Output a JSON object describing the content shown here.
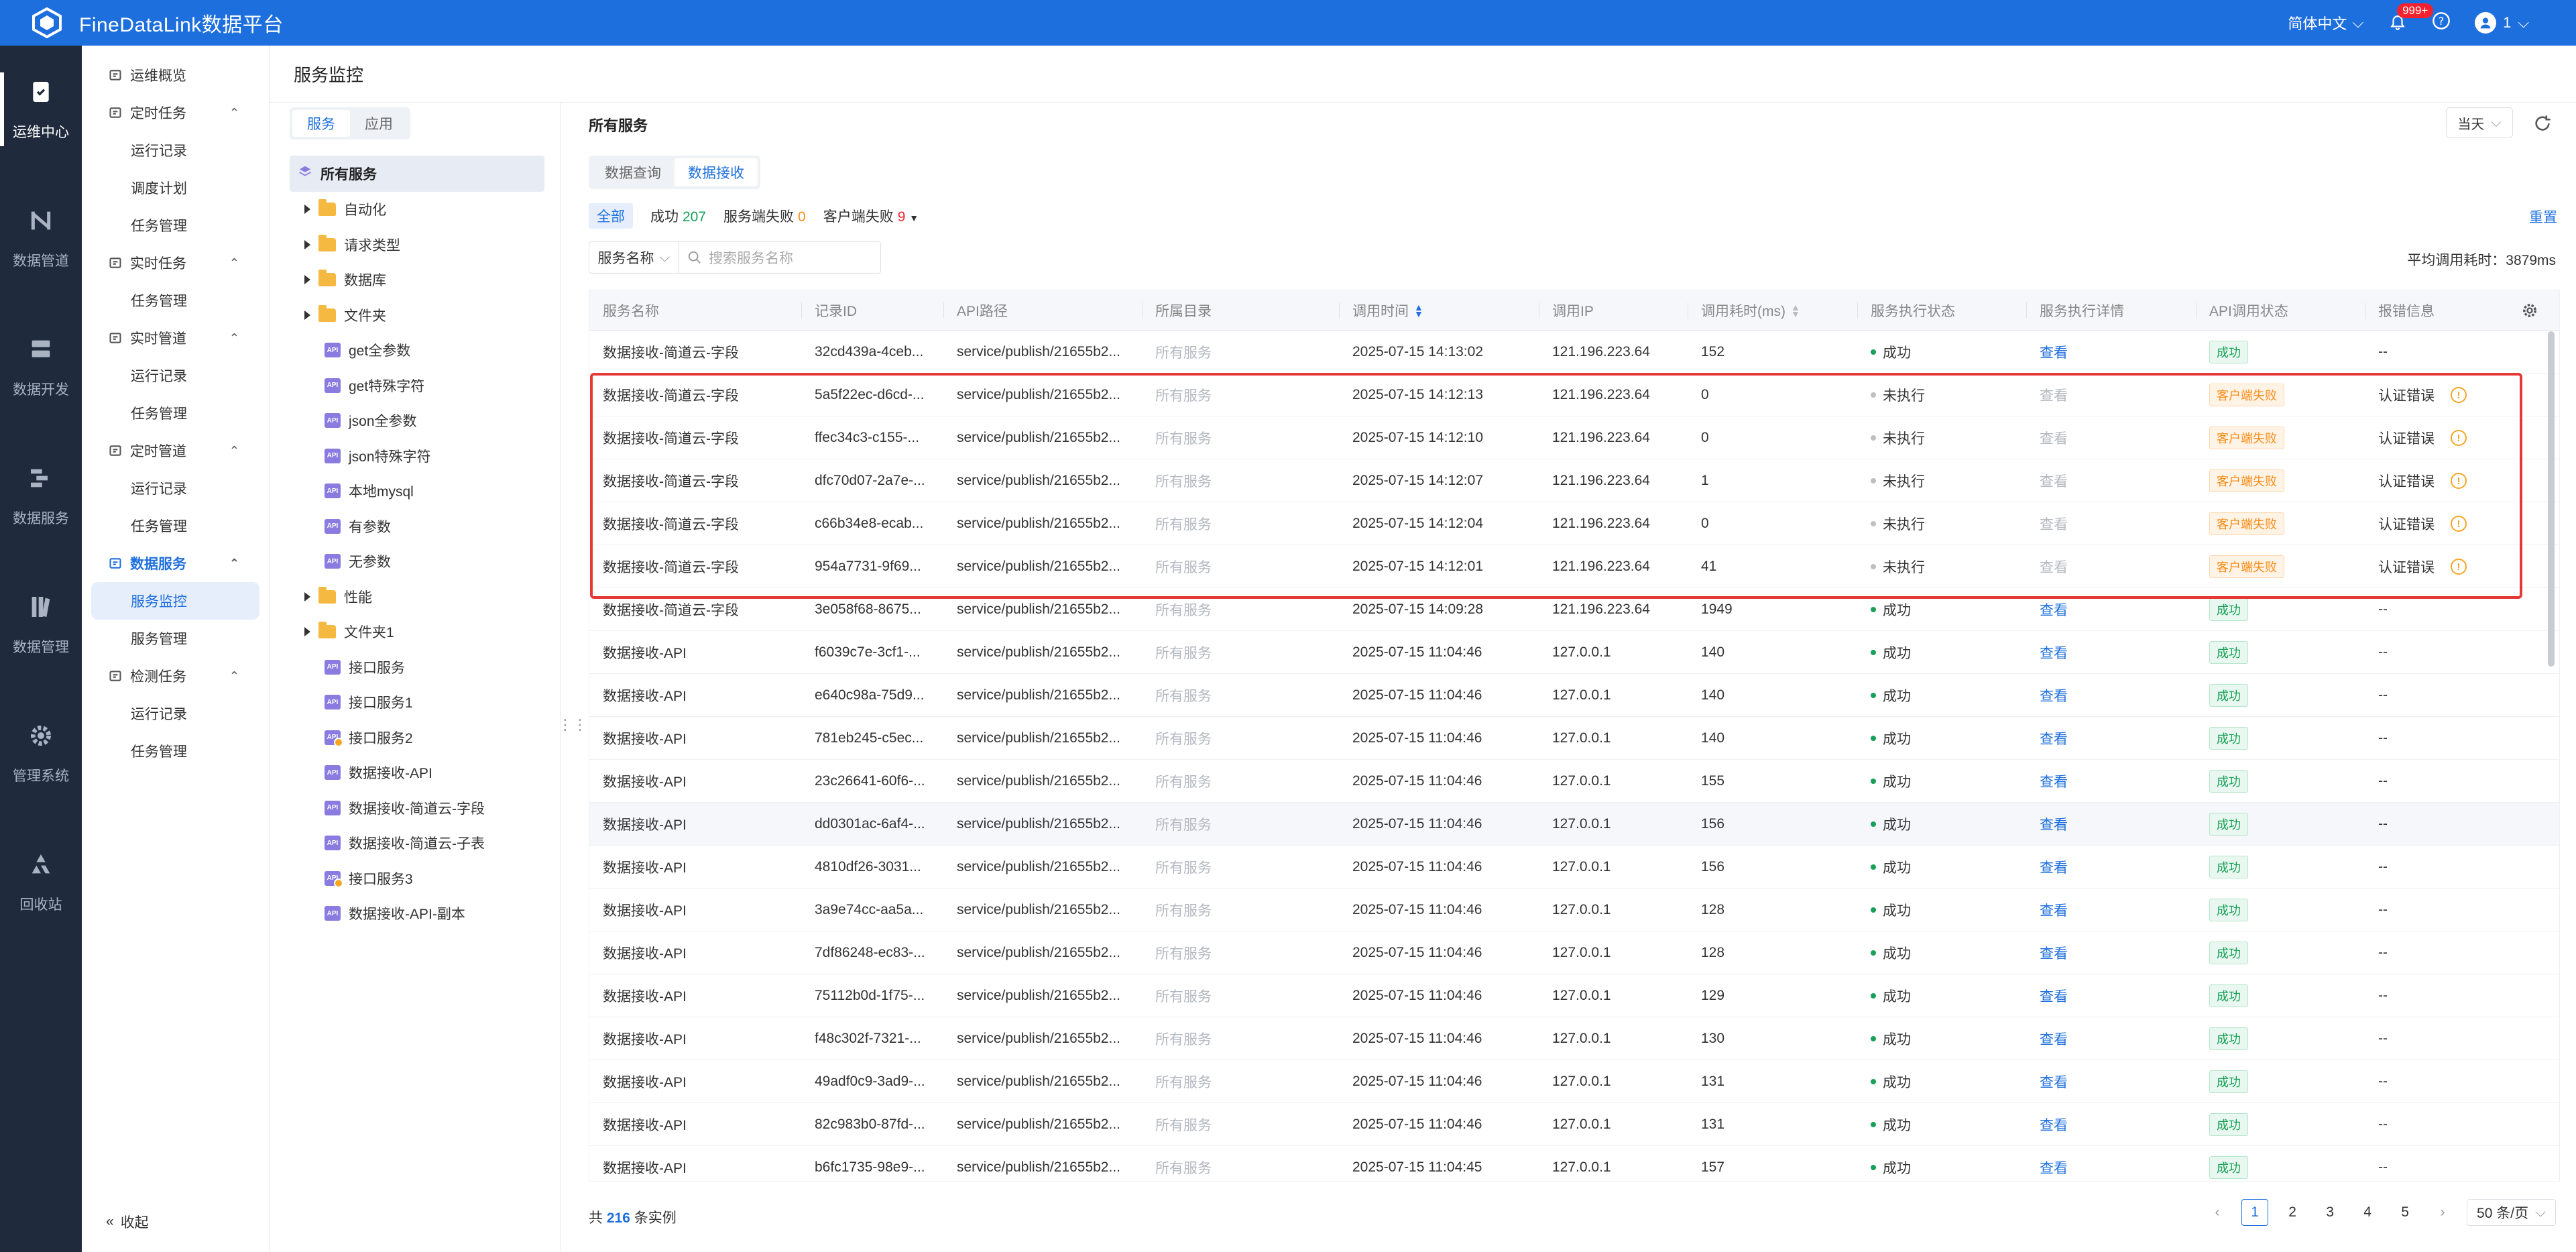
{
  "app": {
    "title": "FineDataLink数据平台"
  },
  "header": {
    "language": "简体中文",
    "notifications_count": "999+",
    "user": "1"
  },
  "rail": [
    {
      "label": "运维中心",
      "icon": "clipboard-icon",
      "active": true
    },
    {
      "label": "数据管道",
      "icon": "pipeline-icon"
    },
    {
      "label": "数据开发",
      "icon": "database-icon"
    },
    {
      "label": "数据服务",
      "icon": "service-icon"
    },
    {
      "label": "数据管理",
      "icon": "management-icon"
    },
    {
      "label": "管理系统",
      "icon": "gear-icon"
    },
    {
      "label": "回收站",
      "icon": "recycle-icon"
    }
  ],
  "menu": {
    "items": [
      {
        "type": "group",
        "label": "运维概览",
        "caret": false
      },
      {
        "type": "group",
        "label": "定时任务",
        "caret": true
      },
      {
        "type": "sub",
        "label": "运行记录"
      },
      {
        "type": "sub",
        "label": "调度计划"
      },
      {
        "type": "sub",
        "label": "任务管理"
      },
      {
        "type": "group",
        "label": "实时任务",
        "caret": true
      },
      {
        "type": "sub",
        "label": "任务管理"
      },
      {
        "type": "group",
        "label": "实时管道",
        "caret": true
      },
      {
        "type": "sub",
        "label": "运行记录"
      },
      {
        "type": "sub",
        "label": "任务管理"
      },
      {
        "type": "group",
        "label": "定时管道",
        "caret": true
      },
      {
        "type": "sub",
        "label": "运行记录"
      },
      {
        "type": "sub",
        "label": "任务管理"
      },
      {
        "type": "group",
        "label": "数据服务",
        "caret": true,
        "on": true
      },
      {
        "type": "sub",
        "label": "服务监控",
        "active": true
      },
      {
        "type": "sub",
        "label": "服务管理"
      },
      {
        "type": "group",
        "label": "检测任务",
        "caret": true
      },
      {
        "type": "sub",
        "label": "运行记录"
      },
      {
        "type": "sub",
        "label": "任务管理"
      }
    ],
    "collapse_label": "收起"
  },
  "page": {
    "title": "服务监控"
  },
  "tree": {
    "seg_tabs": [
      "服务",
      "应用"
    ],
    "root": "所有服务",
    "nodes": [
      {
        "label": "自动化",
        "kind": "folder"
      },
      {
        "label": "请求类型",
        "kind": "folder"
      },
      {
        "label": "数据库",
        "kind": "folder"
      },
      {
        "label": "文件夹",
        "kind": "folder"
      },
      {
        "label": "get全参数",
        "kind": "api"
      },
      {
        "label": "get特殊字符",
        "kind": "api"
      },
      {
        "label": "json全参数",
        "kind": "api"
      },
      {
        "label": "json特殊字符",
        "kind": "api"
      },
      {
        "label": "本地mysql",
        "kind": "api"
      },
      {
        "label": "有参数",
        "kind": "api"
      },
      {
        "label": "无参数",
        "kind": "api"
      },
      {
        "label": "性能",
        "kind": "folder"
      },
      {
        "label": "文件夹1",
        "kind": "folder"
      },
      {
        "label": "接口服务",
        "kind": "api"
      },
      {
        "label": "接口服务1",
        "kind": "api"
      },
      {
        "label": "接口服务2",
        "kind": "api-warn"
      },
      {
        "label": "数据接收-API",
        "kind": "api"
      },
      {
        "label": "数据接收-简道云-字段",
        "kind": "api"
      },
      {
        "label": "数据接收-简道云-子表",
        "kind": "api"
      },
      {
        "label": "接口服务3",
        "kind": "api-warn"
      },
      {
        "label": "数据接收-API-副本",
        "kind": "api"
      }
    ]
  },
  "main": {
    "title": "所有服务",
    "range": "当天",
    "tabs": [
      "数据查询",
      "数据接收"
    ],
    "filters": {
      "all": "全部",
      "success_label": "成功",
      "success_count": "207",
      "server_fail_label": "服务端失败",
      "server_fail_count": "0",
      "client_fail_label": "客户端失败",
      "client_fail_count": "9"
    },
    "reset": "重置",
    "search_select": "服务名称",
    "search_placeholder": "搜索服务名称",
    "avg_label": "平均调用耗时：3879ms"
  },
  "table": {
    "columns": [
      "服务名称",
      "记录ID",
      "API路径",
      "所属目录",
      "调用时间",
      "调用IP",
      "调用耗时(ms)",
      "服务执行状态",
      "服务执行详情",
      "API调用状态",
      "报错信息"
    ],
    "rows": [
      {
        "name": "数据接收-简道云-字段",
        "id": "32cd439a-4ceb...",
        "path": "service/publish/21655b2...",
        "dir": "所有服务",
        "time": "2025-07-15 14:13:02",
        "ip": "121.196.223.64",
        "cost": "152",
        "exec": "成功",
        "detail": "查看",
        "api": "成功",
        "err": "--"
      },
      {
        "name": "数据接收-简道云-字段",
        "id": "5a5f22ec-d6cd-...",
        "path": "service/publish/21655b2...",
        "dir": "所有服务",
        "time": "2025-07-15 14:12:13",
        "ip": "121.196.223.64",
        "cost": "0",
        "exec": "未执行",
        "detail": "查看",
        "api": "客户端失败",
        "err": "认证错误"
      },
      {
        "name": "数据接收-简道云-字段",
        "id": "ffec34c3-c155-...",
        "path": "service/publish/21655b2...",
        "dir": "所有服务",
        "time": "2025-07-15 14:12:10",
        "ip": "121.196.223.64",
        "cost": "0",
        "exec": "未执行",
        "detail": "查看",
        "api": "客户端失败",
        "err": "认证错误"
      },
      {
        "name": "数据接收-简道云-字段",
        "id": "dfc70d07-2a7e-...",
        "path": "service/publish/21655b2...",
        "dir": "所有服务",
        "time": "2025-07-15 14:12:07",
        "ip": "121.196.223.64",
        "cost": "1",
        "exec": "未执行",
        "detail": "查看",
        "api": "客户端失败",
        "err": "认证错误"
      },
      {
        "name": "数据接收-简道云-字段",
        "id": "c66b34e8-ecab...",
        "path": "service/publish/21655b2...",
        "dir": "所有服务",
        "time": "2025-07-15 14:12:04",
        "ip": "121.196.223.64",
        "cost": "0",
        "exec": "未执行",
        "detail": "查看",
        "api": "客户端失败",
        "err": "认证错误"
      },
      {
        "name": "数据接收-简道云-字段",
        "id": "954a7731-9f69...",
        "path": "service/publish/21655b2...",
        "dir": "所有服务",
        "time": "2025-07-15 14:12:01",
        "ip": "121.196.223.64",
        "cost": "41",
        "exec": "未执行",
        "detail": "查看",
        "api": "客户端失败",
        "err": "认证错误"
      },
      {
        "name": "数据接收-简道云-字段",
        "id": "3e058f68-8675...",
        "path": "service/publish/21655b2...",
        "dir": "所有服务",
        "time": "2025-07-15 14:09:28",
        "ip": "121.196.223.64",
        "cost": "1949",
        "exec": "成功",
        "detail": "查看",
        "api": "成功",
        "err": "--"
      },
      {
        "name": "数据接收-API",
        "id": "f6039c7e-3cf1-...",
        "path": "service/publish/21655b2...",
        "dir": "所有服务",
        "time": "2025-07-15 11:04:46",
        "ip": "127.0.0.1",
        "cost": "140",
        "exec": "成功",
        "detail": "查看",
        "api": "成功",
        "err": "--"
      },
      {
        "name": "数据接收-API",
        "id": "e640c98a-75d9...",
        "path": "service/publish/21655b2...",
        "dir": "所有服务",
        "time": "2025-07-15 11:04:46",
        "ip": "127.0.0.1",
        "cost": "140",
        "exec": "成功",
        "detail": "查看",
        "api": "成功",
        "err": "--"
      },
      {
        "name": "数据接收-API",
        "id": "781eb245-c5ec...",
        "path": "service/publish/21655b2...",
        "dir": "所有服务",
        "time": "2025-07-15 11:04:46",
        "ip": "127.0.0.1",
        "cost": "140",
        "exec": "成功",
        "detail": "查看",
        "api": "成功",
        "err": "--"
      },
      {
        "name": "数据接收-API",
        "id": "23c26641-60f6-...",
        "path": "service/publish/21655b2...",
        "dir": "所有服务",
        "time": "2025-07-15 11:04:46",
        "ip": "127.0.0.1",
        "cost": "155",
        "exec": "成功",
        "detail": "查看",
        "api": "成功",
        "err": "--"
      },
      {
        "name": "数据接收-API",
        "id": "dd0301ac-6af4-...",
        "path": "service/publish/21655b2...",
        "dir": "所有服务",
        "time": "2025-07-15 11:04:46",
        "ip": "127.0.0.1",
        "cost": "156",
        "exec": "成功",
        "detail": "查看",
        "api": "成功",
        "err": "--"
      },
      {
        "name": "数据接收-API",
        "id": "4810df26-3031...",
        "path": "service/publish/21655b2...",
        "dir": "所有服务",
        "time": "2025-07-15 11:04:46",
        "ip": "127.0.0.1",
        "cost": "156",
        "exec": "成功",
        "detail": "查看",
        "api": "成功",
        "err": "--"
      },
      {
        "name": "数据接收-API",
        "id": "3a9e74cc-aa5a...",
        "path": "service/publish/21655b2...",
        "dir": "所有服务",
        "time": "2025-07-15 11:04:46",
        "ip": "127.0.0.1",
        "cost": "128",
        "exec": "成功",
        "detail": "查看",
        "api": "成功",
        "err": "--"
      },
      {
        "name": "数据接收-API",
        "id": "7df86248-ec83-...",
        "path": "service/publish/21655b2...",
        "dir": "所有服务",
        "time": "2025-07-15 11:04:46",
        "ip": "127.0.0.1",
        "cost": "128",
        "exec": "成功",
        "detail": "查看",
        "api": "成功",
        "err": "--"
      },
      {
        "name": "数据接收-API",
        "id": "75112b0d-1f75-...",
        "path": "service/publish/21655b2...",
        "dir": "所有服务",
        "time": "2025-07-15 11:04:46",
        "ip": "127.0.0.1",
        "cost": "129",
        "exec": "成功",
        "detail": "查看",
        "api": "成功",
        "err": "--"
      },
      {
        "name": "数据接收-API",
        "id": "f48c302f-7321-...",
        "path": "service/publish/21655b2...",
        "dir": "所有服务",
        "time": "2025-07-15 11:04:46",
        "ip": "127.0.0.1",
        "cost": "130",
        "exec": "成功",
        "detail": "查看",
        "api": "成功",
        "err": "--"
      },
      {
        "name": "数据接收-API",
        "id": "49adf0c9-3ad9-...",
        "path": "service/publish/21655b2...",
        "dir": "所有服务",
        "time": "2025-07-15 11:04:46",
        "ip": "127.0.0.1",
        "cost": "131",
        "exec": "成功",
        "detail": "查看",
        "api": "成功",
        "err": "--"
      },
      {
        "name": "数据接收-API",
        "id": "82c983b0-87fd-...",
        "path": "service/publish/21655b2...",
        "dir": "所有服务",
        "time": "2025-07-15 11:04:46",
        "ip": "127.0.0.1",
        "cost": "131",
        "exec": "成功",
        "detail": "查看",
        "api": "成功",
        "err": "--"
      },
      {
        "name": "数据接收-API",
        "id": "b6fc1735-98e9-...",
        "path": "service/publish/21655b2...",
        "dir": "所有服务",
        "time": "2025-07-15 11:04:45",
        "ip": "127.0.0.1",
        "cost": "157",
        "exec": "成功",
        "detail": "查看",
        "api": "成功",
        "err": "--"
      }
    ]
  },
  "footer": {
    "total_prefix": "共",
    "total_count": "216",
    "total_suffix": "条实例",
    "pages": [
      "1",
      "2",
      "3",
      "4",
      "5"
    ],
    "page_size": "50 条/页"
  },
  "colors": {
    "primary": "#1e6fde",
    "success": "#18a058",
    "warning": "#fa8c16",
    "danger": "#f5222d",
    "highlight_box": "#e53935"
  }
}
